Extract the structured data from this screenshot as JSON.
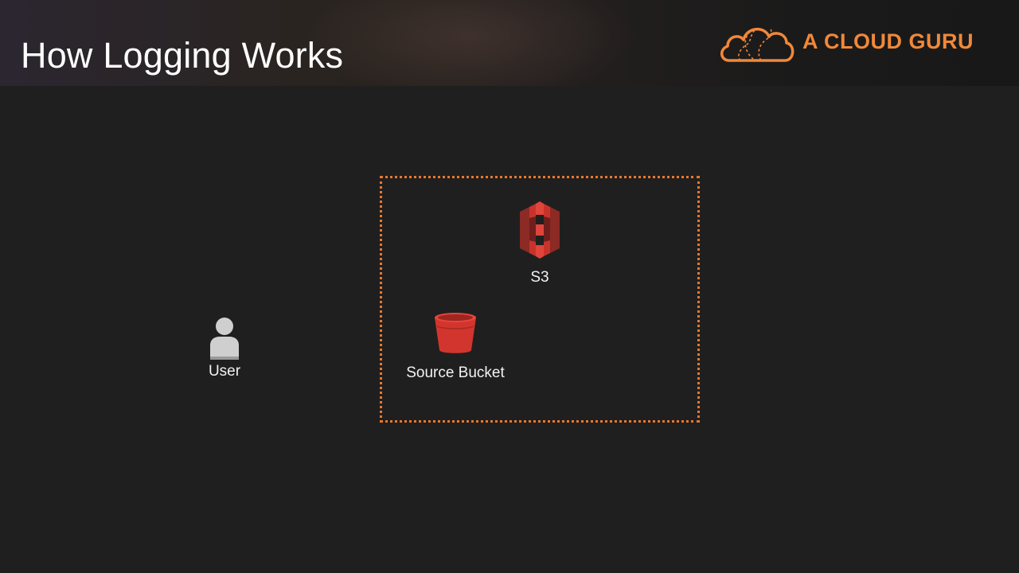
{
  "slide": {
    "title": "How Logging Works"
  },
  "brand": {
    "name": "A CLOUD GURU",
    "accent_color": "#f0883a"
  },
  "diagram": {
    "boundary_color": "#e8772e",
    "nodes": [
      {
        "id": "s3",
        "label": "S3",
        "icon": "aws-s3-icon"
      },
      {
        "id": "source-bucket",
        "label": "Source Bucket",
        "icon": "s3-bucket-icon"
      },
      {
        "id": "user",
        "label": "User",
        "icon": "user-icon"
      }
    ]
  }
}
